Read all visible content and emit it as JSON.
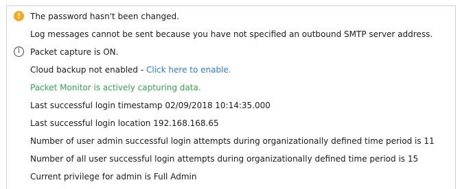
{
  "messages": [
    {
      "icon": "warning-icon",
      "icon_glyph": "!",
      "text": "The password hasn't been changed."
    },
    {
      "text": "Log messages cannot be sent because you have not specified an outbound SMTP server address."
    },
    {
      "icon": "info-icon",
      "icon_glyph": "i",
      "text": "Packet capture is ON."
    },
    {
      "text": "Cloud backup not enabled - ",
      "link": "Click here to enable."
    },
    {
      "text": "Packet Monitor is actively capturing data.",
      "color": "#3aa048"
    },
    {
      "text": "Last successful login timestamp 02/09/2018 10:14:35.000"
    },
    {
      "text": "Last successful login location 192.168.168.65"
    },
    {
      "text": "Number of user admin successful login attempts during organizationally defined time period is 11"
    },
    {
      "text": "Number of all user successful login attempts during organizationally defined time period is 15"
    },
    {
      "text": "Current privilege for admin is Full Admin"
    }
  ],
  "colors": {
    "warning": "#f5a623",
    "link": "#2f7dc4",
    "success": "#3aa048"
  }
}
